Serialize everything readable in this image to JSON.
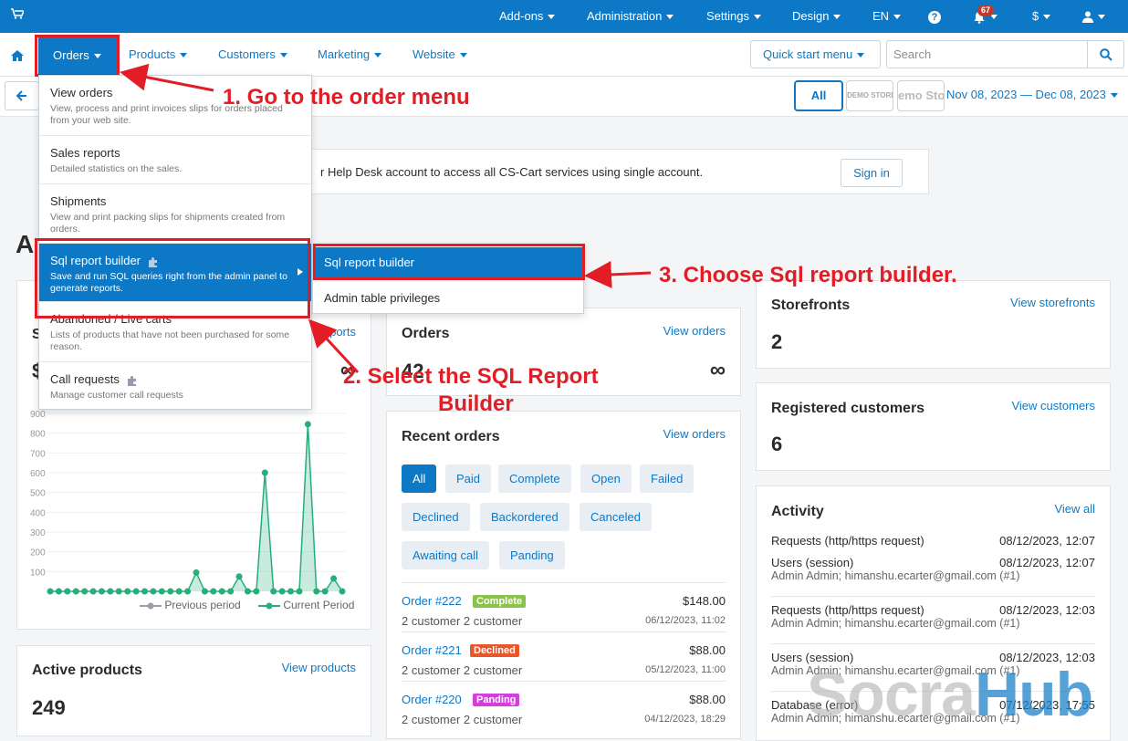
{
  "topbar": {
    "addons": "Add-ons",
    "administration": "Administration",
    "settings": "Settings",
    "design": "Design",
    "lang": "EN",
    "notif_count": "67",
    "currency": "$"
  },
  "nav": {
    "orders": "Orders",
    "products": "Products",
    "customers": "Customers",
    "marketing": "Marketing",
    "website": "Website",
    "quick_start": "Quick start menu",
    "search_placeholder": "Search"
  },
  "toolbar": {
    "all": "All",
    "store1": "DEMO STORE",
    "store2": "emo Sto",
    "date_range": "Nov 08, 2023 — Dec 08, 2023"
  },
  "helpdesk": {
    "text": "r Help Desk account to access all CS-Cart services using single account.",
    "signin": "Sign in"
  },
  "page_heading": "A",
  "orders_menu": [
    {
      "label": "View orders",
      "desc": "View, process and print invoices slips for orders placed from your web site."
    },
    {
      "label": "Sales reports",
      "desc": "Detailed statistics on the sales."
    },
    {
      "label": "Shipments",
      "desc": "View and print packing slips for shipments created from orders."
    },
    {
      "label": "Sql report builder",
      "desc": "Save and run SQL queries right from the admin panel to generate reports."
    },
    {
      "label": "Abandoned / Live carts",
      "desc": "Lists of products that have not been purchased for some reason."
    },
    {
      "label": "Call requests",
      "desc": "Manage customer call requests"
    }
  ],
  "submenu": {
    "item1": "Sql report builder",
    "item2": "Admin table privileges"
  },
  "annotations": {
    "step1": "1. Go to the order menu",
    "step2_line1": "2. Select the SQL Report",
    "step2_line2": "Builder",
    "step3": "3. Choose Sql report builder."
  },
  "sales_card": {
    "title_initial": "S",
    "link": "reports",
    "value_initial": "$",
    "infinity": "∞",
    "legend_prev": "Previous period",
    "legend_curr": "Current Period"
  },
  "chart_data": {
    "type": "area",
    "series": [
      {
        "name": "Previous period",
        "values": [
          0,
          0,
          0,
          0,
          0,
          0,
          0,
          0,
          0,
          0,
          0,
          0,
          0,
          0,
          0,
          0,
          0,
          0,
          0,
          0,
          0,
          0,
          0,
          0,
          0,
          0,
          0,
          0,
          0,
          0,
          0
        ]
      },
      {
        "name": "Current Period",
        "values": [
          0,
          0,
          0,
          0,
          0,
          0,
          0,
          0,
          0,
          0,
          0,
          0,
          0,
          0,
          0,
          0,
          0,
          95,
          0,
          0,
          0,
          0,
          75,
          0,
          0,
          600,
          0,
          0,
          0,
          0,
          845,
          0,
          0,
          65,
          0
        ]
      }
    ],
    "ylim": [
      0,
      900
    ],
    "yticks": [
      100,
      200,
      300,
      400,
      500,
      600,
      700,
      800,
      900
    ],
    "colors": {
      "current": "#27ae7a",
      "previous": "#9aa0a6"
    }
  },
  "orders_card": {
    "title": "Orders",
    "link": "View orders",
    "value": "42",
    "infinity": "∞"
  },
  "recent_orders": {
    "title": "Recent orders",
    "link": "View orders",
    "filters": [
      "All",
      "Paid",
      "Complete",
      "Open",
      "Failed",
      "Declined",
      "Backordered",
      "Canceled",
      "Awaiting call",
      "Panding"
    ],
    "rows": [
      {
        "number": "Order #222",
        "status": "Complete",
        "status_color": "#8bc34a",
        "customer": "2 customer 2 customer",
        "amount": "$148.00",
        "date": "06/12/2023, 11:02"
      },
      {
        "number": "Order #221",
        "status": "Declined",
        "status_color": "#e8562a",
        "customer": "2 customer 2 customer",
        "amount": "$88.00",
        "date": "05/12/2023, 11:00"
      },
      {
        "number": "Order #220",
        "status": "Panding",
        "status_color": "#d63de0",
        "customer": "2 customer 2 customer",
        "amount": "$88.00",
        "date": "04/12/2023, 18:29"
      }
    ]
  },
  "storefronts": {
    "title": "Storefronts",
    "link": "View storefronts",
    "value": "2"
  },
  "registered": {
    "title": "Registered customers",
    "link": "View customers",
    "value": "6"
  },
  "activity": {
    "title": "Activity",
    "link": "View all",
    "items": [
      {
        "label": "Requests (http/https request)",
        "date": "08/12/2023, 12:07",
        "sub": ""
      },
      {
        "label": "Users (session)",
        "date": "08/12/2023, 12:07",
        "sub": "Admin Admin; himanshu.ecarter@gmail.com (#1)"
      },
      {
        "label": "Requests (http/https request)",
        "date": "08/12/2023, 12:03",
        "sub": "Admin Admin; himanshu.ecarter@gmail.com (#1)"
      },
      {
        "label": "Users (session)",
        "date": "08/12/2023, 12:03",
        "sub": "Admin Admin; himanshu.ecarter@gmail.com (#1)"
      },
      {
        "label": "Database (error)",
        "date": "07/12/2023, 17:55",
        "sub": "Admin Admin; himanshu.ecarter@gmail.com (#1)"
      }
    ]
  },
  "active_products": {
    "title": "Active products",
    "link": "View products",
    "value": "249"
  },
  "watermark": {
    "part1": "Socra",
    "part2": "Hub"
  }
}
